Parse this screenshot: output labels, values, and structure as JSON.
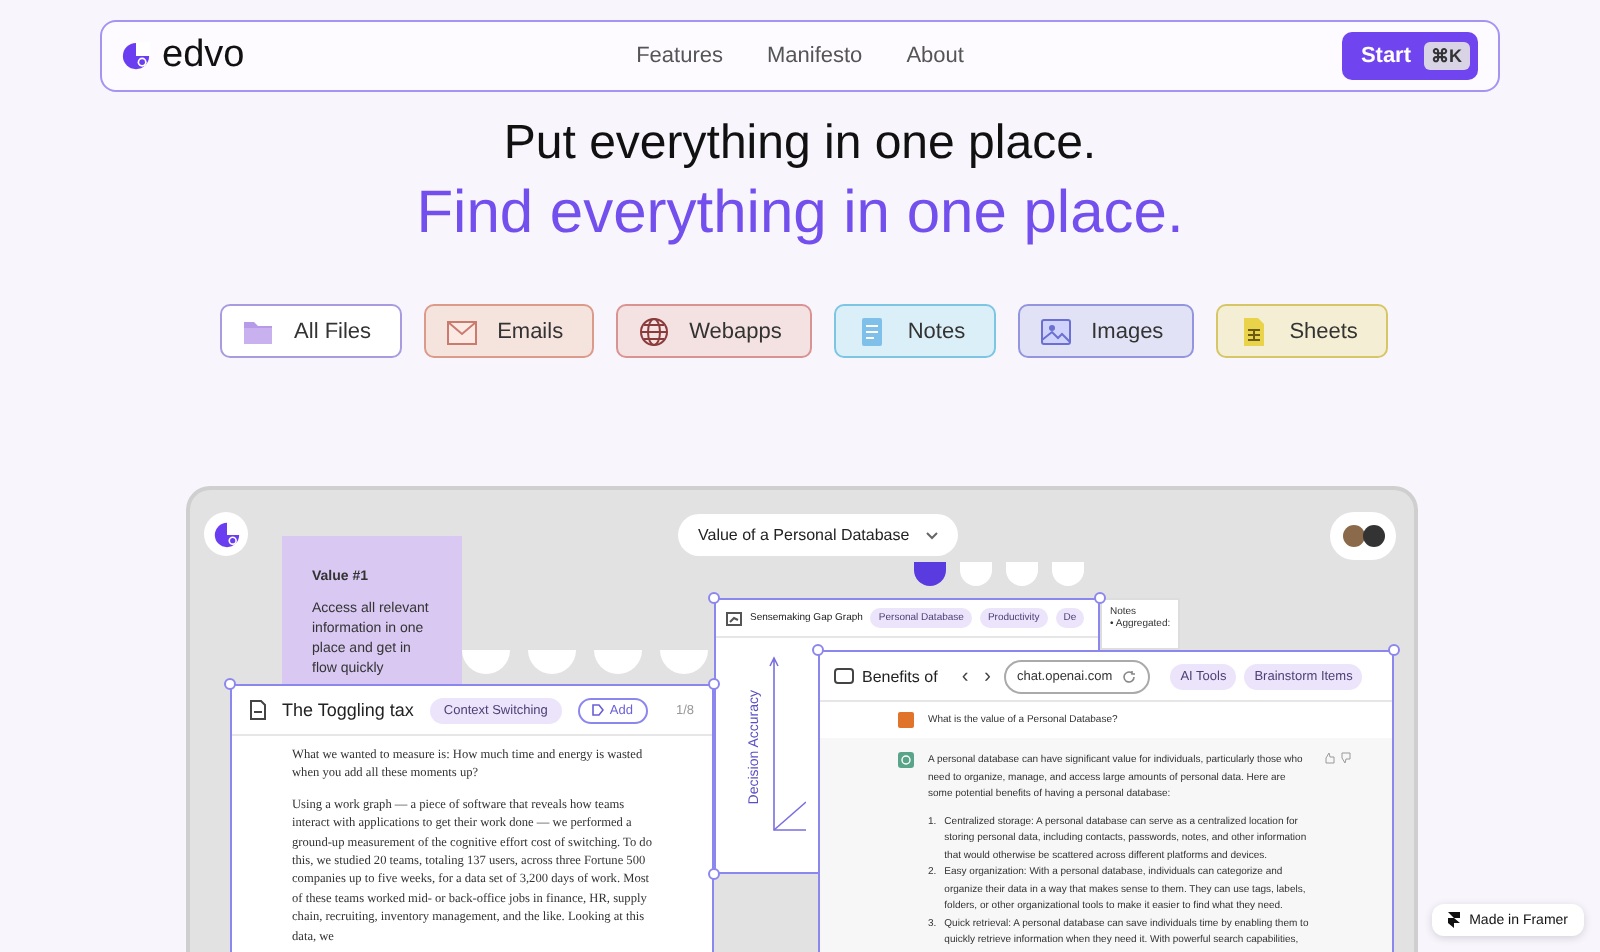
{
  "nav": {
    "brand": "edvo",
    "links": [
      "Features",
      "Manifesto",
      "About"
    ],
    "cta": {
      "label": "Start",
      "shortcut": "⌘K"
    }
  },
  "hero": {
    "line1": "Put everything in one place.",
    "line2": "Find everything in one place."
  },
  "chips": [
    {
      "label": "All Files",
      "kind": "folder",
      "color": "#a99be0"
    },
    {
      "label": "Emails",
      "kind": "mail",
      "color": "#dc9a8a"
    },
    {
      "label": "Webapps",
      "kind": "globe",
      "color": "#d99393"
    },
    {
      "label": "Notes",
      "kind": "note",
      "color": "#7cc6e4"
    },
    {
      "label": "Images",
      "kind": "image",
      "color": "#9396de"
    },
    {
      "label": "Sheets",
      "kind": "sheet",
      "color": "#d6c665"
    }
  ],
  "canvas": {
    "dropdown": "Value of a Personal Database",
    "note_card": {
      "title": "Value #1",
      "body": "Access all relevant information in one place and get in flow quickly"
    },
    "notes_popup": {
      "title": "Notes",
      "item": "• Aggregated:"
    },
    "windows": [
      {
        "kind": "graph",
        "selected": true,
        "title": "Sensemaking Gap Graph",
        "tags": [
          "Personal Database",
          "Productivity",
          "De"
        ],
        "axis_label": "Decision Accuracy"
      },
      {
        "kind": "document",
        "selected": true,
        "title": "The Toggling tax",
        "tags": [
          "Context Switching"
        ],
        "add": "Add",
        "page": "1/8",
        "paragraphs": [
          "What we wanted to measure is: How much time and energy is wasted when you add all these moments up?",
          "Using a work graph — a piece of software that reveals how teams interact with applications to get their work done — we performed a ground-up measurement of the cognitive effort cost of switching. To do this, we studied 20 teams, totaling 137 users, across three Fortune 500 companies up to five weeks, for a data set of 3,200 days of work. Most of these teams worked mid- or back-office jobs in finance, HR, supply chain, recruiting, inventory management, and the like. Looking at this data, we"
        ]
      },
      {
        "kind": "browser",
        "selected": true,
        "title": "Benefits of",
        "back": "‹",
        "forward": "›",
        "url": "chat.openai.com",
        "tags": [
          "AI Tools",
          "Brainstorm Items"
        ],
        "question": "What is the value of a Personal Database?",
        "answer": "A personal database can have significant value for individuals, particularly those who need to organize, manage, and access large amounts of personal data. Here are some potential benefits of having a personal database:",
        "list": [
          {
            "number": "1.",
            "text": "Centralized storage: A personal database can serve as a centralized location for storing personal data, including contacts, passwords, notes, and other information that would otherwise be scattered across different platforms and devices."
          },
          {
            "number": "2.",
            "text": "Easy organization: With a personal database, individuals can categorize and organize their data in a way that makes sense to them. They can use tags, labels, folders, or other organizational tools to make it easier to find what they need."
          },
          {
            "number": "3.",
            "text": "Quick retrieval: A personal database can save individuals time by enabling them to quickly retrieve information when they need it. With powerful search capabilities,"
          }
        ]
      }
    ]
  },
  "badge": "Made in Framer"
}
